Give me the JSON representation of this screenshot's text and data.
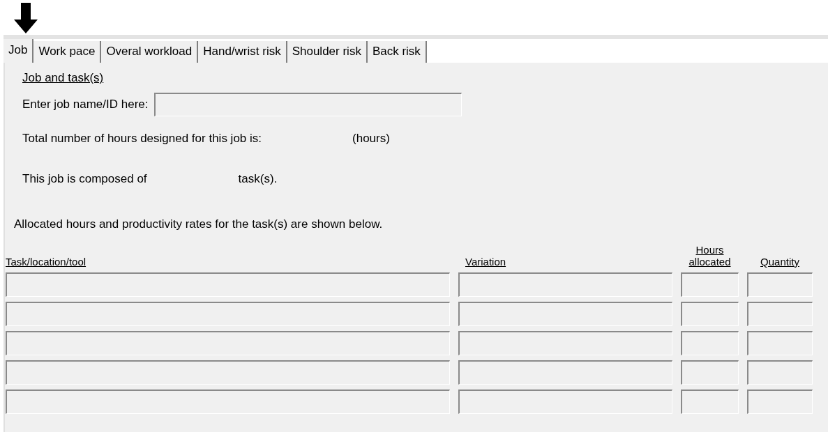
{
  "tabs": [
    {
      "label": "Job",
      "selected": true
    },
    {
      "label": "Work pace",
      "selected": false
    },
    {
      "label": "Overal workload",
      "selected": false
    },
    {
      "label": "Hand/wrist risk",
      "selected": false
    },
    {
      "label": "Shoulder risk",
      "selected": false
    },
    {
      "label": "Back risk",
      "selected": false
    }
  ],
  "section_title": "Job and task(s)",
  "job_name": {
    "label": "Enter job name/ID here:"
  },
  "hours_line": {
    "text": "Total number of hours designed for this job is:",
    "unit": "(hours)"
  },
  "tasks_line": {
    "text": "This job is composed of",
    "unit": "task(s)."
  },
  "intro": "Allocated hours and productivity rates for the task(s) are shown below.",
  "table": {
    "columns": [
      "Task/location/tool",
      "Variation",
      "Hours allocated",
      "Quantity"
    ],
    "rows": [
      {
        "kind": "entry"
      },
      {
        "kind": "entry"
      },
      {
        "kind": "entry"
      },
      {
        "kind": "entry"
      },
      {
        "kind": "entry"
      }
    ]
  }
}
